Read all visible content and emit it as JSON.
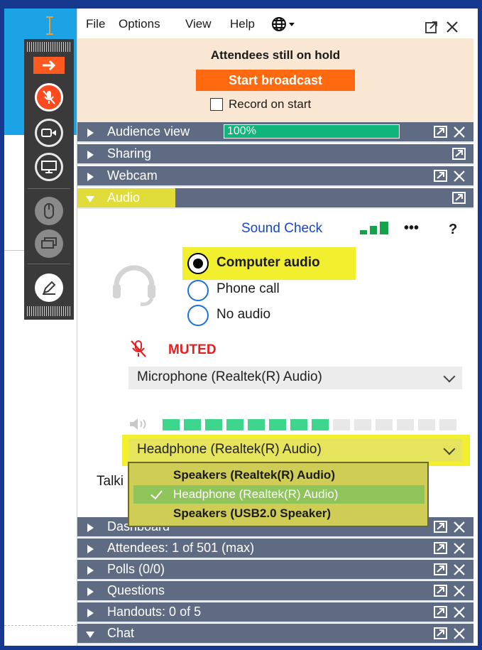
{
  "menubar": {
    "items": [
      "File",
      "Options",
      "View",
      "Help"
    ]
  },
  "hold_panel": {
    "title": "Attendees still on hold",
    "start_button": "Start broadcast",
    "record_label": "Record on start",
    "record_checked": false
  },
  "sections": {
    "audience_view": {
      "label": "Audience view",
      "progress_text": "100%",
      "progress": 1.0
    },
    "sharing": {
      "label": "Sharing"
    },
    "webcam": {
      "label": "Webcam"
    },
    "audio": {
      "label": "Audio"
    },
    "dashboard": {
      "label": "Dashboard"
    },
    "attendees": {
      "label": "Attendees:  1 of 501 (max)"
    },
    "polls": {
      "label": "Polls (0/0)"
    },
    "questions": {
      "label": "Questions"
    },
    "handouts": {
      "label": "Handouts: 0 of 5"
    },
    "chat": {
      "label": "Chat"
    }
  },
  "audio": {
    "sound_check": "Sound Check",
    "more": "•••",
    "help": "?",
    "options": [
      "Computer audio",
      "Phone call",
      "No audio"
    ],
    "selected": "Computer audio",
    "muted_label": "MUTED",
    "microphone": "Microphone (Realtek(R) Audio)",
    "speaker": "Headphone (Realtek(R) Audio)",
    "talking_partial": "Talki",
    "meter_level": 0.57
  },
  "speaker_dropdown": {
    "options": [
      "Speakers (Realtek(R) Audio)",
      "Headphone (Realtek(R) Audio)",
      "Speakers (USB2.0 Speaker)"
    ],
    "selected_index": 1
  },
  "colors": {
    "frame": "#17388f",
    "section_bar": "#5f6b82",
    "start_button": "#ff6a11",
    "hold_background": "#fae7d3",
    "highlight": "#f2ef2e",
    "progress_fill": "#0fb57b",
    "muted_red": "#e81e1e",
    "link_blue": "#1946c8"
  },
  "icons": [
    "cursor-i-beam-icon",
    "arrow-right-icon",
    "mic-muted-icon",
    "webcam-icon",
    "screen-icon",
    "mouse-icon",
    "screen-share-icon",
    "pen-icon",
    "globe-icon",
    "popout-icon",
    "close-icon",
    "headset-icon",
    "signal-bars-icon",
    "chevron-down-icon",
    "speaker-icon",
    "checkmark-icon"
  ]
}
